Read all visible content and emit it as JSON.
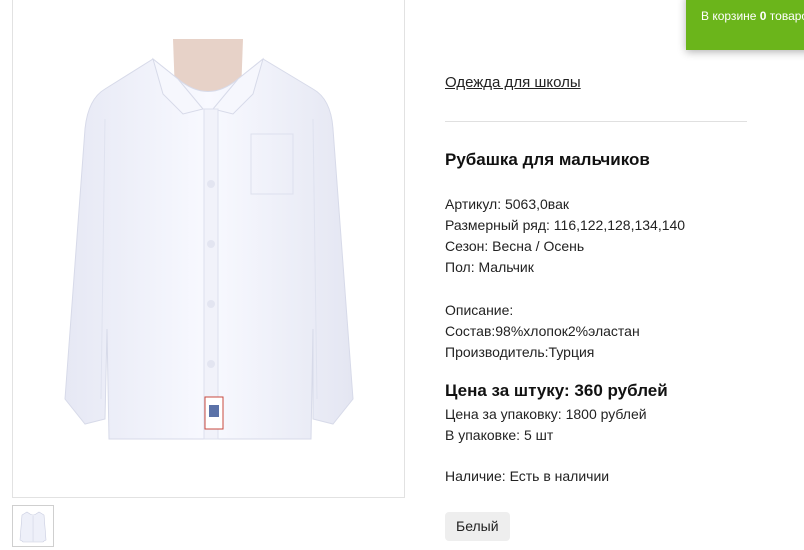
{
  "cart": {
    "prefix": "В корзине ",
    "count": "0",
    "suffix": " товаров"
  },
  "breadcrumb": {
    "category": "Одежда для школы"
  },
  "product": {
    "title": "Рубашка для мальчиков",
    "attributes": [
      "Артикул: 5063,0вак",
      "Размерный ряд: 116,122,128,134,140",
      "Сезон: Весна / Осень",
      "Пол: Мальчик"
    ],
    "description_label": "Описание:",
    "composition": "Состав:98%хлопок2%эластан",
    "manufacturer": "Производитель:Турция",
    "price_per_piece": "Цена за штуку: 360 рублей",
    "price_per_pack": "Цена за упаковку: 1800 рублей",
    "pack_size": "В упаковке: 5 шт",
    "availability": "Наличие: Есть в наличии",
    "color_option": "Белый"
  },
  "colors": {
    "cart_bg": "#6bb51b",
    "shirt": "#f3f4fb"
  }
}
